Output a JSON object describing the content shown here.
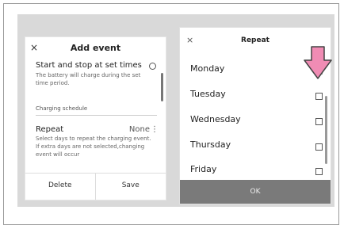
{
  "add_event": {
    "close": "×",
    "title": "Add event",
    "start_stop": {
      "title": "Start and stop at set times",
      "desc": "The battery will charge during the set time period."
    },
    "charging_schedule": "Charging schedule",
    "repeat": {
      "title": "Repeat",
      "value": "None",
      "desc": "Select days to repeat the charging event. If extra days are not selected,changing event will occur"
    },
    "delete_label": "Delete",
    "save_label": "Save"
  },
  "repeat_dialog": {
    "close": "×",
    "title": "Repeat",
    "days": [
      {
        "label": "Monday",
        "checked": true
      },
      {
        "label": "Tuesday",
        "checked": false
      },
      {
        "label": "Wednesday",
        "checked": false
      },
      {
        "label": "Thursday",
        "checked": false
      },
      {
        "label": "Friday",
        "checked": false
      }
    ],
    "ok_label": "OK"
  },
  "colors": {
    "accent_arrow": "#f08cb4",
    "ok_bar": "#7a7a7a"
  }
}
